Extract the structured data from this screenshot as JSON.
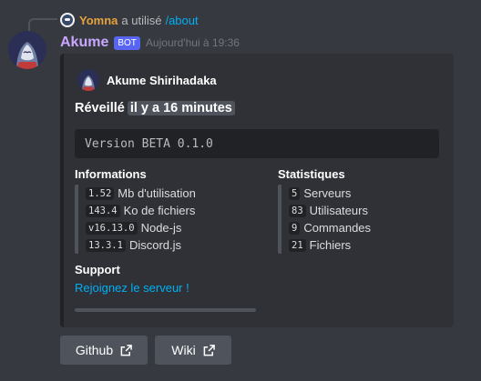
{
  "reply": {
    "user": "Yomna",
    "text": "a utilisé",
    "command": "/about"
  },
  "message": {
    "username": "Akume",
    "bot_tag": "BOT",
    "timestamp": "Aujourd'hui à 19:36"
  },
  "embed": {
    "author": "Akume Shirihadaka",
    "title_prefix": "Réveillé",
    "title_ago": "il y a 16 minutes",
    "codeblock": "Version BETA 0.1.0",
    "fields": {
      "informations": {
        "name": "Informations",
        "items": [
          {
            "code": "1.52",
            "text": "Mb d'utilisation"
          },
          {
            "code": "143.4",
            "text": "Ko de fichiers"
          },
          {
            "code": "v16.13.0",
            "text": "Node-js"
          },
          {
            "code": "13.3.1",
            "text": "Discord.js"
          }
        ]
      },
      "statistiques": {
        "name": "Statistiques",
        "items": [
          {
            "code": "5",
            "text": "Serveurs"
          },
          {
            "code": "83",
            "text": "Utilisateurs"
          },
          {
            "code": "9",
            "text": "Commandes"
          },
          {
            "code": "21",
            "text": "Fichiers"
          }
        ]
      }
    },
    "support": {
      "name": "Support",
      "link_text": "Rejoignez le serveur !"
    }
  },
  "buttons": {
    "github": "Github",
    "wiki": "Wiki"
  },
  "colors": {
    "username": "#c9a6ff",
    "reply_user": "#e6a23c",
    "link": "#00aff4",
    "bot_tag": "#5865f2"
  },
  "icons": {
    "button_icon": "external-link-icon"
  }
}
